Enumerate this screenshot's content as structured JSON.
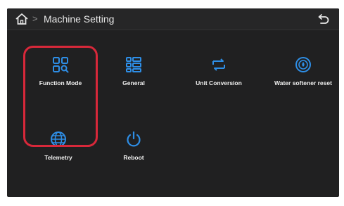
{
  "header": {
    "title": "Machine Setting",
    "separator": ">"
  },
  "tiles": [
    {
      "label": "Function Mode",
      "icon": "grid-search-icon"
    },
    {
      "label": "General",
      "icon": "list-icon"
    },
    {
      "label": "Unit Conversion",
      "icon": "swap-arrows-icon"
    },
    {
      "label": "Water softener reset",
      "icon": "water-softener-icon"
    },
    {
      "label": "Telemetry",
      "icon": "globe-icon"
    },
    {
      "label": "Reboot",
      "icon": "power-icon"
    }
  ],
  "colors": {
    "accent": "#2e8ee6",
    "background": "#202021",
    "highlight": "#d8283a"
  }
}
